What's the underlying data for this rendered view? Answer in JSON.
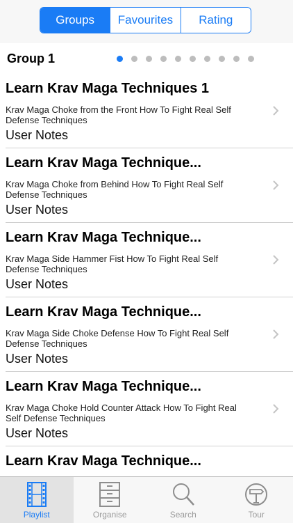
{
  "segments": {
    "items": [
      {
        "label": "Groups",
        "active": true
      },
      {
        "label": "Favourites",
        "active": false
      },
      {
        "label": "Rating",
        "active": false
      }
    ]
  },
  "group": {
    "title": "Group 1",
    "page_count": 10,
    "current_page": 1
  },
  "rows": [
    {
      "title": "Learn Krav Maga Techniques 1",
      "subtitle": "Krav Maga Choke from the Front How To Fight Real Self Defense Techniques",
      "notes": "User Notes"
    },
    {
      "title": "Learn Krav Maga Technique...",
      "subtitle": "Krav Maga Choke from Behind How To Fight Real Self Defense Techniques",
      "notes": "User Notes"
    },
    {
      "title": "Learn Krav Maga Technique...",
      "subtitle": "Krav Maga Side Hammer Fist How To Fight Real Self Defense Techniques",
      "notes": "User Notes"
    },
    {
      "title": "Learn Krav Maga Technique...",
      "subtitle": "Krav Maga Side Choke Defense How To Fight Real Self Defense Techniques",
      "notes": "User Notes"
    },
    {
      "title": "Learn Krav Maga Technique...",
      "subtitle": "Krav Maga Choke Hold Counter Attack How To Fight Real Self Defense Techniques",
      "notes": "User Notes"
    },
    {
      "title": "Learn Krav Maga Technique...",
      "subtitle": "",
      "notes": ""
    }
  ],
  "tabbar": {
    "items": [
      {
        "label": "Playlist",
        "icon": "film-strip-icon",
        "active": true
      },
      {
        "label": "Organise",
        "icon": "cabinet-icon",
        "active": false
      },
      {
        "label": "Search",
        "icon": "magnifier-icon",
        "active": false
      },
      {
        "label": "Tour",
        "icon": "signpost-icon",
        "active": false
      }
    ]
  },
  "colors": {
    "accent": "#1a7cf5",
    "inactive": "#9a9a9a",
    "dot_inactive": "#bdbdbd"
  }
}
